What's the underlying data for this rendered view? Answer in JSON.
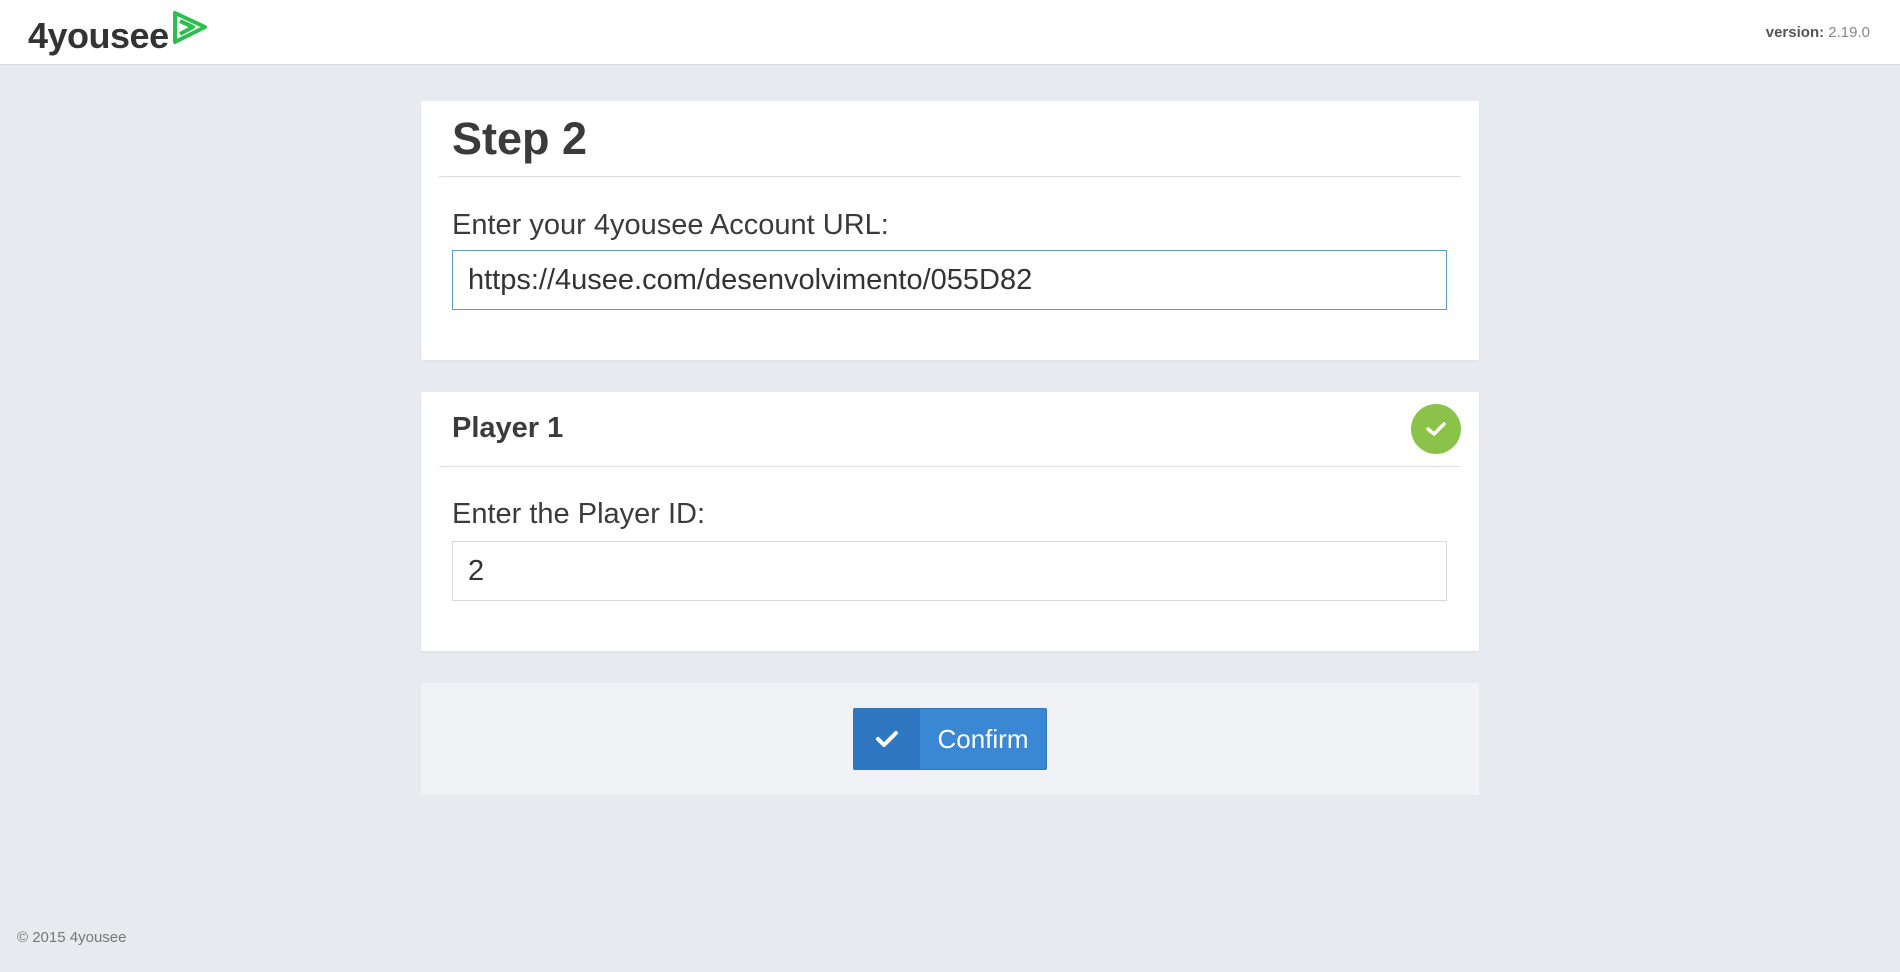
{
  "header": {
    "logo_text": "4yousee",
    "logo_icon": "play-triangle-icon",
    "brand_color": "#2dbe4f",
    "version_label": "version:",
    "version_value": "2.19.0"
  },
  "step_card": {
    "title": "Step 2",
    "url_label": "Enter your 4yousee Account URL:",
    "url_value": "https://4usee.com/desenvolvimento/055D82"
  },
  "player_card": {
    "title": "Player 1",
    "status_icon": "check-circle-icon",
    "status_color": "#8bc34a",
    "id_label": "Enter the Player ID:",
    "id_value": "2"
  },
  "actions": {
    "confirm_label": "Confirm",
    "confirm_icon": "check-icon",
    "confirm_color": "#3a87d4"
  },
  "footer": {
    "copyright": "© 2015 4yousee"
  }
}
